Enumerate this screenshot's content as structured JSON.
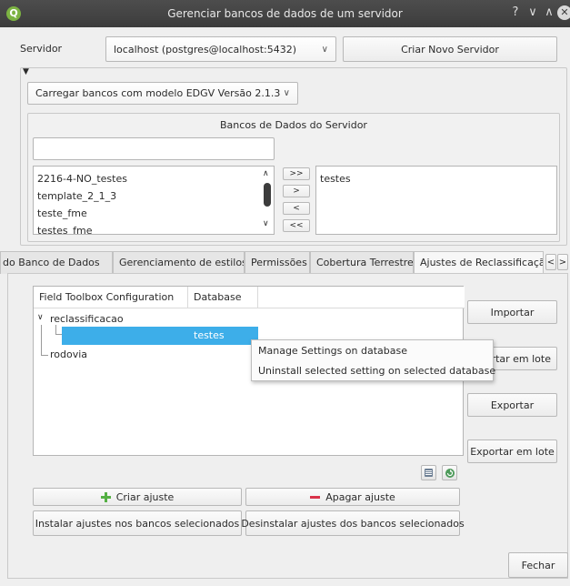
{
  "window": {
    "title": "Gerenciar bancos de dados de um servidor",
    "controls": [
      "?",
      "∨",
      "∧",
      "✕"
    ]
  },
  "server": {
    "label": "Servidor",
    "selected": "localhost (postgres@localhost:5432)",
    "create_button": "Criar Novo Servidor"
  },
  "model_combo": "Carregar bancos com modelo EDGV Versão 2.1.3",
  "databases": {
    "title": "Bancos de Dados do Servidor",
    "filter_value": "",
    "available": [
      "2216-4-NO_testes",
      "template_2_1_3",
      "teste_fme",
      "testes_fme"
    ],
    "transfer_buttons": [
      ">>",
      ">",
      "<",
      "<<"
    ],
    "selected": [
      "testes"
    ]
  },
  "tabs": [
    {
      "label": "do Banco de Dados",
      "active": false
    },
    {
      "label": "Gerenciamento de estilos",
      "active": false
    },
    {
      "label": "Permissões",
      "active": false
    },
    {
      "label": "Cobertura Terrestre",
      "active": false
    },
    {
      "label": "Ajustes de Reclassificação",
      "active": true
    }
  ],
  "tab_scroll": [
    "<",
    ">"
  ],
  "tree": {
    "columns": [
      "Field Toolbox Configuration",
      "Database"
    ],
    "items": [
      {
        "label": "reclassificacao",
        "expanded": true,
        "children": [
          {
            "label": "",
            "database": "testes",
            "selected": true
          }
        ]
      },
      {
        "label": "rodovia"
      }
    ]
  },
  "context_menu": [
    "Manage Settings on database",
    "Uninstall selected setting on selected database"
  ],
  "side_buttons": {
    "import": "Importar",
    "import_batch": "Importar em lote",
    "import_batch_visible": "rtar em lote",
    "export": "Exportar",
    "export_batch": "Exportar em lote"
  },
  "bottom": {
    "create": "Criar ajuste",
    "delete": "Apagar ajuste",
    "install": "Instalar ajustes nos bancos selecionados",
    "uninstall": "Desinstalar ajustes dos bancos selecionados",
    "close": "Fechar"
  },
  "colors": {
    "selection": "#3daee9",
    "add_icon": "#55b044",
    "remove_icon": "#d9334a"
  }
}
